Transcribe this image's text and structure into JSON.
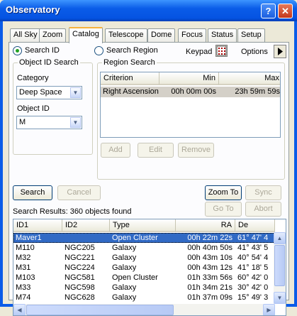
{
  "window": {
    "title": "Observatory",
    "help": "?",
    "close": "✕"
  },
  "tabs": [
    "All Sky",
    "Zoom",
    "Catalog",
    "Telescope",
    "Dome",
    "Focus",
    "Status",
    "Setup"
  ],
  "search_mode": {
    "id_label": "Search ID",
    "region_label": "Search Region",
    "selected": "Search ID"
  },
  "keypad": {
    "label": "Keypad"
  },
  "options": {
    "label": "Options"
  },
  "object_id_search": {
    "title": "Object ID Search",
    "category_label": "Category",
    "category_value": "Deep Space",
    "object_id_label": "Object ID",
    "object_id_value": "M"
  },
  "region_search": {
    "title": "Region Search",
    "columns": [
      "Criterion",
      "Min",
      "Max"
    ],
    "rows": [
      {
        "criterion": "Right Ascension",
        "min": "00h 00m 00s",
        "max": "23h 59m 59s"
      }
    ],
    "add": "Add",
    "edit": "Edit",
    "remove": "Remove"
  },
  "actions": {
    "search": "Search",
    "cancel": "Cancel",
    "zoom_to": "Zoom To",
    "sync": "Sync",
    "go_to": "Go To",
    "abort": "Abort"
  },
  "results": {
    "summary": "Search Results: 360 objects found",
    "columns": [
      "ID1",
      "ID2",
      "Type",
      "RA",
      "De"
    ],
    "rows": [
      {
        "id1": "Maver1",
        "id2": "",
        "type": "Open Cluster",
        "ra": "00h 22m 22s",
        "dec": "61° 47' 4",
        "selected": true
      },
      {
        "id1": "M110",
        "id2": "NGC205",
        "type": "Galaxy",
        "ra": "00h 40m 50s",
        "dec": "41° 43' 5"
      },
      {
        "id1": "M32",
        "id2": "NGC221",
        "type": "Galaxy",
        "ra": "00h 43m 10s",
        "dec": "40° 54' 4"
      },
      {
        "id1": "M31",
        "id2": "NGC224",
        "type": "Galaxy",
        "ra": "00h 43m 12s",
        "dec": "41° 18' 5"
      },
      {
        "id1": "M103",
        "id2": "NGC581",
        "type": "Open Cluster",
        "ra": "01h 33m 56s",
        "dec": "60° 42' 0"
      },
      {
        "id1": "M33",
        "id2": "NGC598",
        "type": "Galaxy",
        "ra": "01h 34m 21s",
        "dec": "30° 42' 0"
      },
      {
        "id1": "M74",
        "id2": "NGC628",
        "type": "Galaxy",
        "ra": "01h 37m 09s",
        "dec": "15° 49' 3"
      }
    ]
  },
  "colors": {
    "selection": "#316ac5",
    "titlebar": "#0a5ce8",
    "tab_highlight": "#f7b33d"
  }
}
